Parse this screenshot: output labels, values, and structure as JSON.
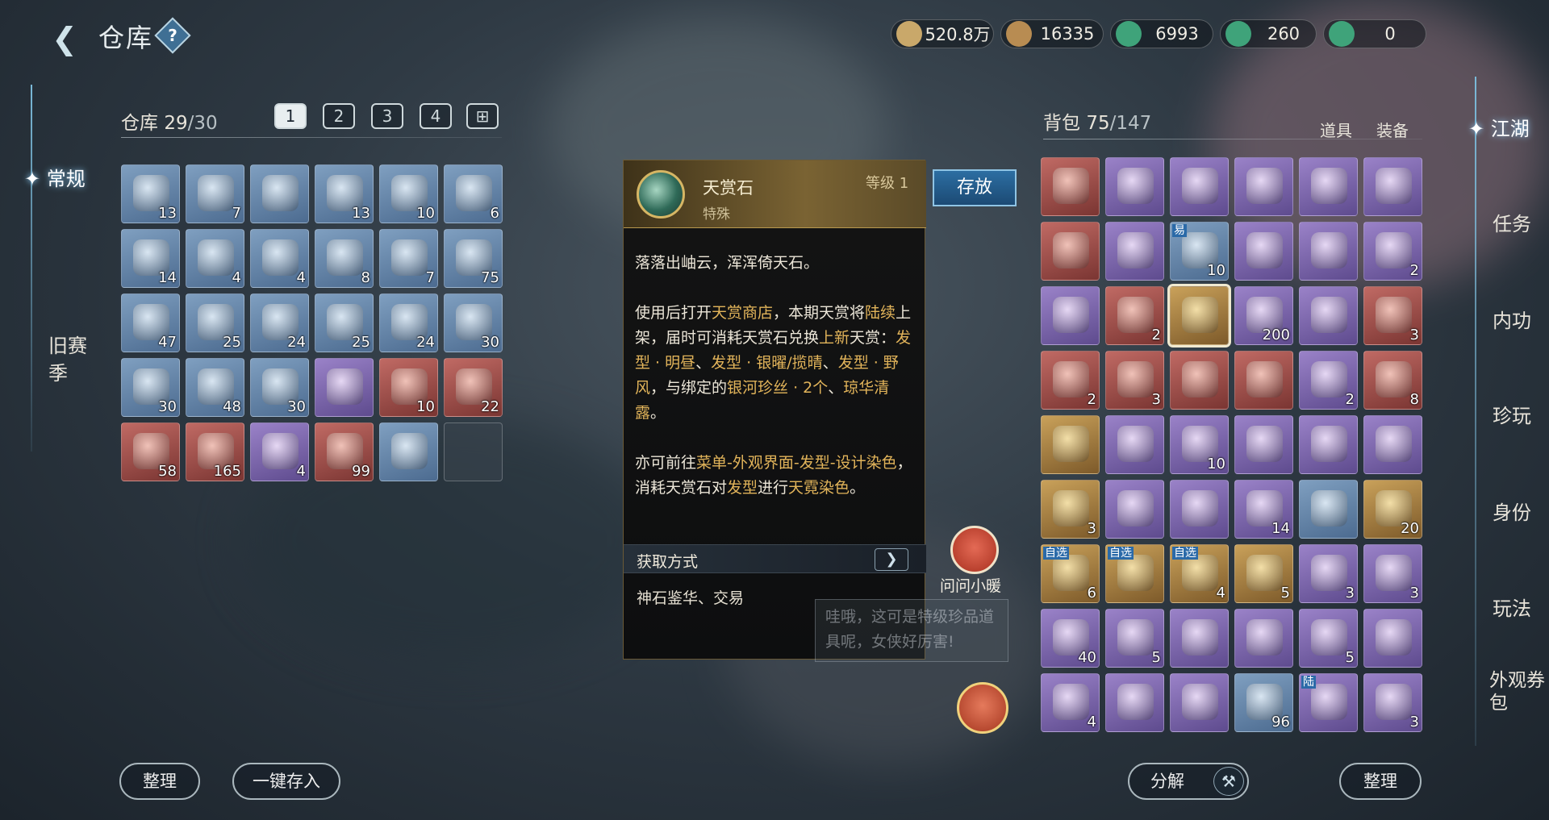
{
  "header": {
    "title": "仓库",
    "back_icon": "back-arrow-icon",
    "help_label": "?"
  },
  "currencies": [
    {
      "icon": "scroll-currency-icon",
      "value": "520.8万",
      "color": "#c9a86a"
    },
    {
      "icon": "copper-coin-icon",
      "value": "16335",
      "color": "#b88c52"
    },
    {
      "icon": "jade-coin-icon",
      "value": "6993",
      "color": "#3fa37a"
    },
    {
      "icon": "jade-coin-bound-icon",
      "value": "260",
      "color": "#3fa37a"
    },
    {
      "icon": "jade-coin-alt-icon",
      "value": "0",
      "color": "#3fa37a"
    }
  ],
  "left_nav": [
    {
      "label": "常规",
      "active": true
    },
    {
      "label": "旧赛季",
      "active": false
    }
  ],
  "warehouse": {
    "label": "仓库",
    "used": "29",
    "total": "/30",
    "tabs": [
      "1",
      "2",
      "3",
      "4",
      "⊞"
    ],
    "items": [
      {
        "icon": "heart-candy-icon",
        "count": "13",
        "q": "blue"
      },
      {
        "icon": "heart-candy-icon",
        "count": "7",
        "q": "blue"
      },
      {
        "icon": "heart-candy-icon",
        "count": "",
        "q": "blue"
      },
      {
        "icon": "heart-candy-icon",
        "count": "13",
        "q": "blue"
      },
      {
        "icon": "heart-candy-icon",
        "count": "10",
        "q": "blue"
      },
      {
        "icon": "heart-candy-icon",
        "count": "6",
        "q": "blue"
      },
      {
        "icon": "double-heart-icon",
        "count": "14",
        "q": "blue"
      },
      {
        "icon": "double-heart-icon",
        "count": "4",
        "q": "blue"
      },
      {
        "icon": "yellow-lantern-icon",
        "count": "4",
        "q": "blue"
      },
      {
        "icon": "purple-lantern-icon",
        "count": "8",
        "q": "blue"
      },
      {
        "icon": "red-lantern-icon",
        "count": "7",
        "q": "blue"
      },
      {
        "icon": "firework-tube-icon",
        "count": "75",
        "q": "blue"
      },
      {
        "icon": "firework-tube-icon",
        "count": "47",
        "q": "blue"
      },
      {
        "icon": "firework-tube-icon",
        "count": "25",
        "q": "blue"
      },
      {
        "icon": "firework-tube-icon",
        "count": "24",
        "q": "blue"
      },
      {
        "icon": "firework-tube-icon",
        "count": "25",
        "q": "blue"
      },
      {
        "icon": "firework-tube-icon",
        "count": "24",
        "q": "blue"
      },
      {
        "icon": "sparkle-heart-icon",
        "count": "30",
        "q": "blue"
      },
      {
        "icon": "sparkle-heart-icon",
        "count": "30",
        "q": "blue"
      },
      {
        "icon": "cat-lantern-icon",
        "count": "48",
        "q": "blue"
      },
      {
        "icon": "tiger-face-icon",
        "count": "30",
        "q": "blue"
      },
      {
        "icon": "purple-crystal-icon",
        "count": "",
        "q": "purple"
      },
      {
        "icon": "scroll-icon",
        "count": "10",
        "q": "red"
      },
      {
        "icon": "gift-box-icon",
        "count": "22",
        "q": "red"
      },
      {
        "icon": "firecracker-bundle-icon",
        "count": "58",
        "q": "red"
      },
      {
        "icon": "red-stick-icon",
        "count": "165",
        "q": "red"
      },
      {
        "icon": "magic-wand-icon",
        "count": "4",
        "q": "purple"
      },
      {
        "icon": "golden-horn-icon",
        "count": "99",
        "q": "red"
      },
      {
        "icon": "pipa-instrument-icon",
        "count": "",
        "q": "blue"
      },
      {
        "icon": "empty-slot",
        "count": "",
        "q": "empty"
      }
    ]
  },
  "backpack": {
    "label": "背包",
    "used": "75",
    "total": "/147",
    "tab_items": "道具",
    "tab_equip": "装备",
    "items": [
      {
        "icon": "bronze-ring-icon",
        "count": "",
        "q": "red",
        "tag": ""
      },
      {
        "icon": "fire-emblem-icon",
        "count": "",
        "q": "purple",
        "tag": ""
      },
      {
        "icon": "spear-icon",
        "count": "",
        "q": "purple",
        "tag": ""
      },
      {
        "icon": "shoulder-armor-icon",
        "count": "",
        "q": "purple",
        "tag": ""
      },
      {
        "icon": "belt-icon",
        "count": "",
        "q": "purple",
        "tag": ""
      },
      {
        "icon": "ruby-ring-icon",
        "count": "",
        "q": "purple",
        "tag": ""
      },
      {
        "icon": "blue-ring-icon",
        "count": "",
        "q": "red",
        "tag": ""
      },
      {
        "icon": "crown-helmet-icon",
        "count": "",
        "q": "purple",
        "tag": ""
      },
      {
        "icon": "hotpot-bowl-icon",
        "count": "10",
        "q": "blue",
        "tag": "易"
      },
      {
        "icon": "purple-chest-icon",
        "count": "",
        "q": "purple",
        "tag": ""
      },
      {
        "icon": "gold-ticket-icon",
        "count": "",
        "q": "purple",
        "tag": ""
      },
      {
        "icon": "blue-gem-icon",
        "count": "2",
        "q": "purple",
        "tag": ""
      },
      {
        "icon": "crystal-butterfly-icon",
        "count": "",
        "q": "purple",
        "tag": ""
      },
      {
        "icon": "rose-bouquet-icon",
        "count": "2",
        "q": "red",
        "tag": ""
      },
      {
        "icon": "tianshang-stone-icon",
        "count": "",
        "q": "gold",
        "tag": "",
        "sel": true
      },
      {
        "icon": "gold-coin-icon",
        "count": "200",
        "q": "purple",
        "tag": ""
      },
      {
        "icon": "blue-diamond-icon",
        "count": "",
        "q": "purple",
        "tag": ""
      },
      {
        "icon": "blue-scroll-icon",
        "count": "3",
        "q": "red",
        "tag": ""
      },
      {
        "icon": "red-box-icon",
        "count": "2",
        "q": "red",
        "tag": ""
      },
      {
        "icon": "firework-bundle-icon",
        "count": "3",
        "q": "red",
        "tag": ""
      },
      {
        "icon": "red-tube-icon",
        "count": "",
        "q": "red",
        "tag": ""
      },
      {
        "icon": "round-table-icon",
        "count": "",
        "q": "red",
        "tag": ""
      },
      {
        "icon": "bronze-compass-icon",
        "count": "2",
        "q": "purple",
        "tag": ""
      },
      {
        "icon": "ore-rock-icon",
        "count": "8",
        "q": "red",
        "tag": ""
      },
      {
        "icon": "blue-crystal-icon",
        "count": "",
        "q": "gold",
        "tag": ""
      },
      {
        "icon": "gold-chest-open-icon",
        "count": "",
        "q": "purple",
        "tag": ""
      },
      {
        "icon": "jade-orb-icon",
        "count": "10",
        "q": "purple",
        "tag": ""
      },
      {
        "icon": "robe-armor-icon",
        "count": "",
        "q": "purple",
        "tag": ""
      },
      {
        "icon": "red-armor-icon",
        "count": "",
        "q": "purple",
        "tag": ""
      },
      {
        "icon": "red-armor-alt-icon",
        "count": "",
        "q": "purple",
        "tag": ""
      },
      {
        "icon": "gold-chest-icon",
        "count": "3",
        "q": "gold",
        "tag": ""
      },
      {
        "icon": "gold-ring-icon",
        "count": "",
        "q": "purple",
        "tag": ""
      },
      {
        "icon": "gold-ring-icon",
        "count": "",
        "q": "purple",
        "tag": ""
      },
      {
        "icon": "white-gourd-icon",
        "count": "14",
        "q": "purple",
        "tag": ""
      },
      {
        "icon": "red-giftbox-icon",
        "count": "",
        "q": "blue",
        "tag": ""
      },
      {
        "icon": "red-envelope-icon",
        "count": "20",
        "q": "gold",
        "tag": ""
      },
      {
        "icon": "gold-chest-icon",
        "count": "6",
        "q": "gold",
        "tag": "自选"
      },
      {
        "icon": "gold-chest-icon",
        "count": "",
        "q": "gold",
        "tag": "自选"
      },
      {
        "icon": "gold-chest-icon",
        "count": "4",
        "q": "gold",
        "tag": "自选"
      },
      {
        "icon": "gold-chest-icon",
        "count": "5",
        "q": "gold",
        "tag": ""
      },
      {
        "icon": "scroll-paper-icon",
        "count": "3",
        "q": "purple",
        "tag": ""
      },
      {
        "icon": "crystal-sphere-icon",
        "count": "3",
        "q": "purple",
        "tag": ""
      },
      {
        "icon": "wood-chest-icon",
        "count": "40",
        "q": "purple",
        "tag": ""
      },
      {
        "icon": "wood-logs-icon",
        "count": "5",
        "q": "purple",
        "tag": ""
      },
      {
        "icon": "pet-fox-icon",
        "count": "",
        "q": "purple",
        "tag": ""
      },
      {
        "icon": "gold-pendant-icon",
        "count": "",
        "q": "purple",
        "tag": ""
      },
      {
        "icon": "purple-giftbox-icon",
        "count": "5",
        "q": "purple",
        "tag": ""
      },
      {
        "icon": "gold-scroll-icon",
        "count": "",
        "q": "purple",
        "tag": ""
      },
      {
        "icon": "swirl-orb-icon",
        "count": "4",
        "q": "purple",
        "tag": ""
      },
      {
        "icon": "girl-avatar-icon",
        "count": "",
        "q": "purple",
        "tag": ""
      },
      {
        "icon": "red-hair-avatar-icon",
        "count": "",
        "q": "purple",
        "tag": ""
      },
      {
        "icon": "cake-bun-icon",
        "count": "96",
        "q": "blue",
        "tag": ""
      },
      {
        "icon": "armor-piece-icon",
        "count": "",
        "q": "purple",
        "tag": "陆"
      },
      {
        "icon": "red-banner-icon",
        "count": "3",
        "q": "purple",
        "tag": ""
      }
    ]
  },
  "right_nav": [
    "江湖",
    "任务",
    "内功",
    "珍玩",
    "身份",
    "玩法",
    "外观券包"
  ],
  "tooltip": {
    "name": "天赏石",
    "type": "特殊",
    "level": "等级 1",
    "store_button": "存放",
    "para1": "落落出岫云，浑浑倚天石。",
    "para2_parts": [
      {
        "t": "使用后打开",
        "h": false
      },
      {
        "t": "天赏商店",
        "h": true
      },
      {
        "t": "，本期天赏将",
        "h": false
      },
      {
        "t": "陆续",
        "h": true
      },
      {
        "t": "上架，届时可消耗天赏石兑换",
        "h": false
      },
      {
        "t": "上新",
        "h": true
      },
      {
        "t": "天赏：",
        "h": false
      },
      {
        "t": "发型 · 明昼",
        "h": true
      },
      {
        "t": "、",
        "h": false
      },
      {
        "t": "发型 · 银曜/揽晴",
        "h": true
      },
      {
        "t": "、",
        "h": false
      },
      {
        "t": "发型 · 野风",
        "h": true
      },
      {
        "t": "，与绑定的",
        "h": false
      },
      {
        "t": "银河珍丝 · 2个",
        "h": true
      },
      {
        "t": "、",
        "h": false
      },
      {
        "t": "琼华清露",
        "h": true
      },
      {
        "t": "。",
        "h": false
      }
    ],
    "para3_parts": [
      {
        "t": "亦可前往",
        "h": false
      },
      {
        "t": "菜单-外观界面-发型-设计染色",
        "h": true
      },
      {
        "t": "，消耗天赏石对",
        "h": false
      },
      {
        "t": "发型",
        "h": true
      },
      {
        "t": "进行",
        "h": false
      },
      {
        "t": "天霓染色",
        "h": true
      },
      {
        "t": "。",
        "h": false
      }
    ],
    "acquire_label": "获取方式",
    "acquire_sources": "神石鉴华、交易"
  },
  "assistant": {
    "label": "问问小暖",
    "speech": "哇哦，这可是特级珍品道具呢，女侠好厉害!"
  },
  "buttons": {
    "ws_sort": "整理",
    "deposit_all": "一键存入",
    "decompose": "分解",
    "bp_sort": "整理"
  },
  "quality_colors": {
    "blue": "#6f8fb2",
    "purple": "#7e68b0",
    "red": "#a34e4a",
    "gold": "#b58a44"
  }
}
